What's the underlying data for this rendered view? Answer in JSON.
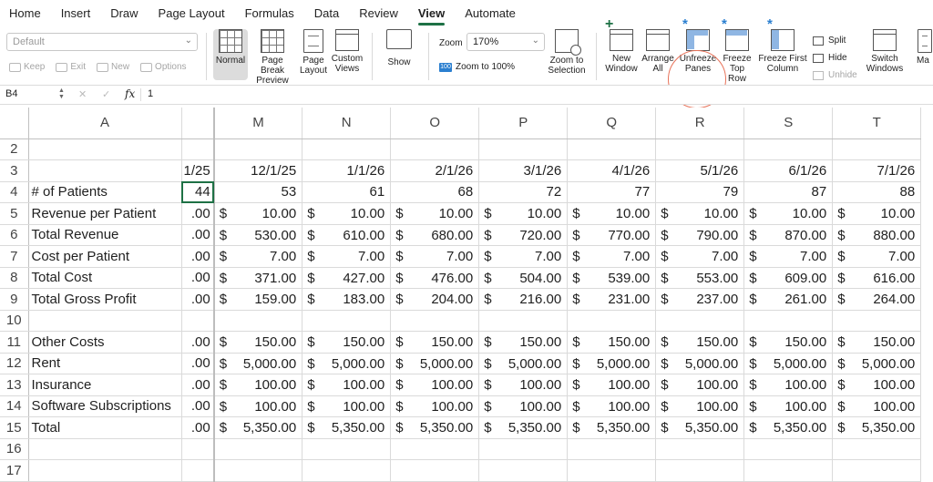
{
  "tabs": [
    "Home",
    "Insert",
    "Draw",
    "Page Layout",
    "Formulas",
    "Data",
    "Review",
    "View",
    "Automate"
  ],
  "active_tab": "View",
  "ribbon": {
    "sheet_style": "Default",
    "sheet_view": {
      "keep": "Keep",
      "exit": "Exit",
      "new": "New",
      "options": "Options"
    },
    "normal": "Normal",
    "page_break_preview": "Page Break\nPreview",
    "page_layout": "Page\nLayout",
    "custom_views": "Custom\nViews",
    "show": "Show",
    "zoom_label": "Zoom",
    "zoom_value": "170%",
    "zoom_100": "Zoom to 100%",
    "zoom_to_selection": "Zoom to\nSelection",
    "new_window": "New\nWindow",
    "arrange_all": "Arrange\nAll",
    "unfreeze_panes": "Unfreeze\nPanes",
    "freeze_top_row": "Freeze\nTop Row",
    "freeze_first_column": "Freeze First\nColumn",
    "split": "Split",
    "hide": "Hide",
    "unhide": "Unhide",
    "switch_windows": "Switch\nWindows",
    "more": "Ma"
  },
  "formula_bar": {
    "cell_ref": "B4",
    "fx": "fx",
    "value": "1"
  },
  "columns": [
    "A",
    "",
    "M",
    "N",
    "O",
    "P",
    "Q",
    "R",
    "S",
    "T"
  ],
  "rows": [
    {
      "n": "2",
      "label": "",
      "partial": "",
      "cells": [
        "",
        "",
        "",
        "",
        "",
        "",
        "",
        ""
      ]
    },
    {
      "n": "3",
      "label": "",
      "partial": "1/25",
      "cells": [
        "12/1/25",
        "1/1/26",
        "2/1/26",
        "3/1/26",
        "4/1/26",
        "5/1/26",
        "6/1/26",
        "7/1/26"
      ]
    },
    {
      "n": "4",
      "label": "# of Patients",
      "partial": "44",
      "cells": [
        "53",
        "61",
        "68",
        "72",
        "77",
        "79",
        "87",
        "88"
      ]
    },
    {
      "n": "5",
      "label": "Revenue per Patient",
      "partial": ".00",
      "money": true,
      "cells": [
        "10.00",
        "10.00",
        "10.00",
        "10.00",
        "10.00",
        "10.00",
        "10.00",
        "10.00"
      ]
    },
    {
      "n": "6",
      "label": "Total Revenue",
      "partial": ".00",
      "money": true,
      "cells": [
        "530.00",
        "610.00",
        "680.00",
        "720.00",
        "770.00",
        "790.00",
        "870.00",
        "880.00"
      ]
    },
    {
      "n": "7",
      "label": "Cost per Patient",
      "partial": ".00",
      "money": true,
      "cells": [
        "7.00",
        "7.00",
        "7.00",
        "7.00",
        "7.00",
        "7.00",
        "7.00",
        "7.00"
      ]
    },
    {
      "n": "8",
      "label": "Total Cost",
      "partial": ".00",
      "money": true,
      "cells": [
        "371.00",
        "427.00",
        "476.00",
        "504.00",
        "539.00",
        "553.00",
        "609.00",
        "616.00"
      ]
    },
    {
      "n": "9",
      "label": "Total Gross Profit",
      "partial": ".00",
      "money": true,
      "cells": [
        "159.00",
        "183.00",
        "204.00",
        "216.00",
        "231.00",
        "237.00",
        "261.00",
        "264.00"
      ]
    },
    {
      "n": "10",
      "label": "",
      "partial": "",
      "cells": [
        "",
        "",
        "",
        "",
        "",
        "",
        "",
        ""
      ]
    },
    {
      "n": "11",
      "label": "Other Costs",
      "partial": ".00",
      "money": true,
      "cells": [
        "150.00",
        "150.00",
        "150.00",
        "150.00",
        "150.00",
        "150.00",
        "150.00",
        "150.00"
      ]
    },
    {
      "n": "12",
      "label": "Rent",
      "partial": ".00",
      "money": true,
      "cells": [
        "5,000.00",
        "5,000.00",
        "5,000.00",
        "5,000.00",
        "5,000.00",
        "5,000.00",
        "5,000.00",
        "5,000.00"
      ]
    },
    {
      "n": "13",
      "label": "Insurance",
      "partial": ".00",
      "money": true,
      "cells": [
        "100.00",
        "100.00",
        "100.00",
        "100.00",
        "100.00",
        "100.00",
        "100.00",
        "100.00"
      ]
    },
    {
      "n": "14",
      "label": "Software Subscriptions",
      "partial": ".00",
      "money": true,
      "cells": [
        "100.00",
        "100.00",
        "100.00",
        "100.00",
        "100.00",
        "100.00",
        "100.00",
        "100.00"
      ]
    },
    {
      "n": "15",
      "label": "Total",
      "partial": ".00",
      "money": true,
      "cells": [
        "5,350.00",
        "5,350.00",
        "5,350.00",
        "5,350.00",
        "5,350.00",
        "5,350.00",
        "5,350.00",
        "5,350.00"
      ]
    },
    {
      "n": "16",
      "label": "",
      "partial": "",
      "cells": [
        "",
        "",
        "",
        "",
        "",
        "",
        "",
        ""
      ]
    },
    {
      "n": "17",
      "label": "",
      "partial": "",
      "cells": [
        "",
        "",
        "",
        "",
        "",
        "",
        "",
        ""
      ]
    }
  ],
  "currency_symbol": "$",
  "colors": {
    "accent": "#1e7145",
    "highlight": "#e8735a",
    "icon_blue": "#2a7fd0"
  }
}
